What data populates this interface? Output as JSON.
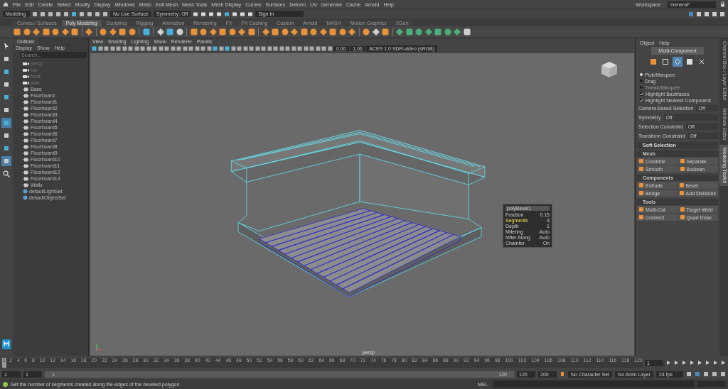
{
  "menu_bar": [
    "File",
    "Edit",
    "Create",
    "Select",
    "Modify",
    "Display",
    "Windows",
    "Mesh",
    "Edit Mesh",
    "Mesh Tools",
    "Mesh Display",
    "Curves",
    "Surfaces",
    "Deform",
    "UV",
    "Generate",
    "Cache",
    "Arnold",
    "Help"
  ],
  "status_line": {
    "menu_set": "Modeling",
    "live_surface": "No Live Surface",
    "symmetry": "Symmetry: Off",
    "sign_in": "Sign In"
  },
  "workspace": {
    "label": "Workspace :",
    "value": "General*"
  },
  "shelf_tabs": [
    {
      "label": "Curves / Surfaces",
      "selected": false
    },
    {
      "label": "Poly Modeling",
      "selected": true
    },
    {
      "label": "Sculpting",
      "selected": false
    },
    {
      "label": "Rigging",
      "selected": false
    },
    {
      "label": "Animation",
      "selected": false
    },
    {
      "label": "Rendering",
      "selected": false
    },
    {
      "label": "FX",
      "selected": false
    },
    {
      "label": "FX Caching",
      "selected": false
    },
    {
      "label": "Custom",
      "selected": false
    },
    {
      "label": "Arnold",
      "selected": false
    },
    {
      "label": "MASH",
      "selected": false
    },
    {
      "label": "Motion Graphics",
      "selected": false
    },
    {
      "label": "XGen",
      "selected": false
    }
  ],
  "outliner": {
    "tab": "Outliner",
    "menu": [
      "Display",
      "Show",
      "Help"
    ],
    "search": {
      "placeholder": "Search..."
    },
    "items": [
      {
        "kind": "camera",
        "label": "persp",
        "dimmed": true
      },
      {
        "kind": "camera",
        "label": "top",
        "dimmed": true
      },
      {
        "kind": "camera",
        "label": "front",
        "dimmed": true
      },
      {
        "kind": "camera",
        "label": "side",
        "dimmed": true
      },
      {
        "kind": "mesh",
        "label": "Base",
        "dimmed": false
      },
      {
        "kind": "mesh",
        "label": "Floorboard",
        "dimmed": false
      },
      {
        "kind": "mesh",
        "label": "Floorboard1",
        "dimmed": false
      },
      {
        "kind": "mesh",
        "label": "Floorboard2",
        "dimmed": false
      },
      {
        "kind": "mesh",
        "label": "Floorboard3",
        "dimmed": false
      },
      {
        "kind": "mesh",
        "label": "Floorboard4",
        "dimmed": false
      },
      {
        "kind": "mesh",
        "label": "Floorboard5",
        "dimmed": false
      },
      {
        "kind": "mesh",
        "label": "Floorboard6",
        "dimmed": false
      },
      {
        "kind": "mesh",
        "label": "Floorboard7",
        "dimmed": false
      },
      {
        "kind": "mesh",
        "label": "Floorboard8",
        "dimmed": false
      },
      {
        "kind": "mesh",
        "label": "Floorboard9",
        "dimmed": false
      },
      {
        "kind": "mesh",
        "label": "Floorboard10",
        "dimmed": false
      },
      {
        "kind": "mesh",
        "label": "Floorboard11",
        "dimmed": false
      },
      {
        "kind": "mesh",
        "label": "Floorboard12",
        "dimmed": false
      },
      {
        "kind": "mesh",
        "label": "Floorboard13",
        "dimmed": false
      },
      {
        "kind": "mesh",
        "label": "Walls",
        "dimmed": false
      },
      {
        "kind": "set",
        "label": "defaultLightSet",
        "dimmed": false
      },
      {
        "kind": "set",
        "label": "defaultObjectSet",
        "dimmed": false
      }
    ]
  },
  "viewport": {
    "menu": [
      "View",
      "Shading",
      "Lighting",
      "Show",
      "Renderer",
      "Panels"
    ],
    "exposure": "0.00",
    "gamma": "1.00",
    "color_space": "ACES 1.0 SDR-video (sRGB)",
    "camera": "persp",
    "bevel_popup": {
      "title": "polyBevel1",
      "rows": [
        {
          "label": "Fraction",
          "value": "0.15",
          "selected": false
        },
        {
          "label": "Segments",
          "value": "3",
          "selected": true
        },
        {
          "label": "Depth",
          "value": "1",
          "selected": false
        },
        {
          "label": "Mitering",
          "value": "Auto",
          "selected": false
        },
        {
          "label": "Miter Along",
          "value": "Auto",
          "selected": false
        },
        {
          "label": "Chamfer",
          "value": "On",
          "selected": false
        }
      ]
    }
  },
  "modeling_toolkit": {
    "menu": [
      "Object",
      "Help"
    ],
    "mode_button": "Multi-Component",
    "selection_modes": [
      {
        "selected": false
      },
      {
        "selected": false
      },
      {
        "selected": true
      },
      {
        "selected": false
      },
      {
        "selected": false
      }
    ],
    "pick_modes": [
      {
        "label": "Pick/Marquee",
        "selected": true,
        "disabled": false
      },
      {
        "label": "Drag",
        "selected": false,
        "disabled": false
      },
      {
        "label": "Tweak/Marquee",
        "selected": false,
        "disabled": true
      }
    ],
    "options": [
      {
        "label": "Highlight Backfaces",
        "checked": true
      },
      {
        "label": "Highlight Nearest Component",
        "checked": true
      }
    ],
    "settings": [
      {
        "label": "Camera Based Selection",
        "value": "Off"
      },
      {
        "label": "Symmetry",
        "value": "Off"
      },
      {
        "label": "Selection Constraint",
        "value": "Off"
      },
      {
        "label": "Transform Constraint",
        "value": "Off"
      }
    ],
    "sections": [
      {
        "title": "Soft Selection",
        "expanded": false
      },
      {
        "title": "Mesh",
        "expanded": true,
        "tools": [
          "Combine",
          "Separate",
          "Smooth",
          "Boolean"
        ]
      },
      {
        "title": "Components",
        "expanded": true,
        "tools": [
          "Extrude",
          "Bevel",
          "Bridge",
          "Add Divisions"
        ]
      },
      {
        "title": "Tools",
        "expanded": true,
        "tools": [
          "Multi-Cut",
          "Target Weld",
          "Connect",
          "Quad Draw"
        ]
      }
    ]
  },
  "side_tabs": [
    {
      "label": "Channel Box / Layer Editor",
      "selected": false
    },
    {
      "label": "Attribute Editor",
      "selected": false
    },
    {
      "label": "Modeling Toolkit",
      "selected": true
    }
  ],
  "time_slider": {
    "ticks": [
      "2",
      "4",
      "6",
      "8",
      "10",
      "12",
      "14",
      "16",
      "18",
      "20",
      "22",
      "24",
      "26",
      "28",
      "30",
      "32",
      "34",
      "36",
      "38",
      "40",
      "42",
      "44",
      "46",
      "48",
      "50",
      "52",
      "54",
      "56",
      "58",
      "60",
      "62",
      "64",
      "66",
      "68",
      "70",
      "72",
      "74",
      "76",
      "78",
      "80",
      "82",
      "84",
      "86",
      "88",
      "90",
      "92",
      "94",
      "96",
      "98",
      "100",
      "102",
      "104",
      "106",
      "108",
      "110",
      "112",
      "114",
      "116",
      "118",
      "120"
    ],
    "current_frame": "1",
    "level": 0,
    "frame_field": "1"
  },
  "range_slider": {
    "start": "1",
    "playback_start": "1",
    "range_start": "1",
    "range_end": "120",
    "playback_end": "120",
    "end": "200",
    "character_set": "No Character Set",
    "anim_layer": "No Anim Layer",
    "fps": "24 fps"
  },
  "help_line": {
    "text": "Set the number of segments created along the edges of the beveled polygon.",
    "command_label": "MEL"
  }
}
